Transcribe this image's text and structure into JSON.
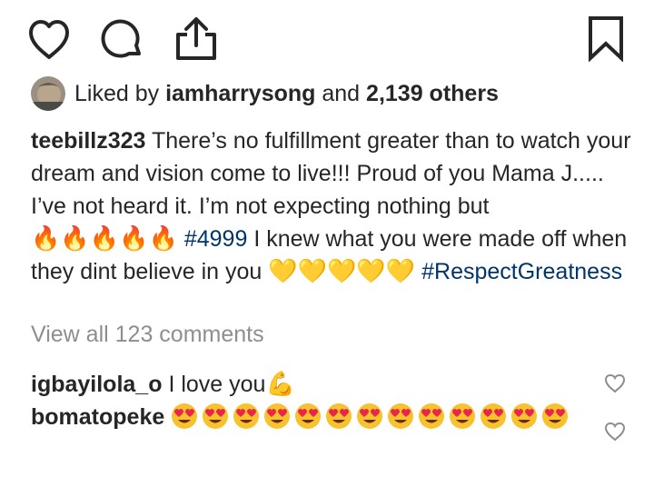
{
  "actions": {
    "like_icon": "heart-outline-icon",
    "comment_icon": "speech-bubble-icon",
    "share_icon": "share-upload-icon",
    "save_icon": "bookmark-outline-icon"
  },
  "likes": {
    "prefix": "Liked by",
    "user": "iamharrysong",
    "joiner": "and",
    "others": "2,139 others"
  },
  "caption": {
    "username": "teebillz323",
    "text_part1": "There’s no fulfillment greater than to watch your dream and vision come to live!!! Proud of you Mama J..... I’ve not heard it. I’m not expecting nothing but",
    "fire_emojis": "🔥🔥🔥🔥🔥",
    "hashtag1": "#4999",
    "text_part2": "I knew what you were made off when they dint believe in you",
    "yellow_hearts": "💛💛💛💛💛",
    "hashtag2": "#RespectGreatness"
  },
  "view_all_comments": "View all 123 comments",
  "comments": [
    {
      "username": "igbayilola_o",
      "text": "I love you",
      "emoji": "💪"
    },
    {
      "username": "bomatopeke",
      "text": "",
      "emoji_count": 13,
      "emoji_name": "heart-eyes-emoji"
    }
  ],
  "colors": {
    "text": "#262626",
    "muted": "#8e8e8e",
    "hashtag": "#003569",
    "icon": "#262626"
  }
}
